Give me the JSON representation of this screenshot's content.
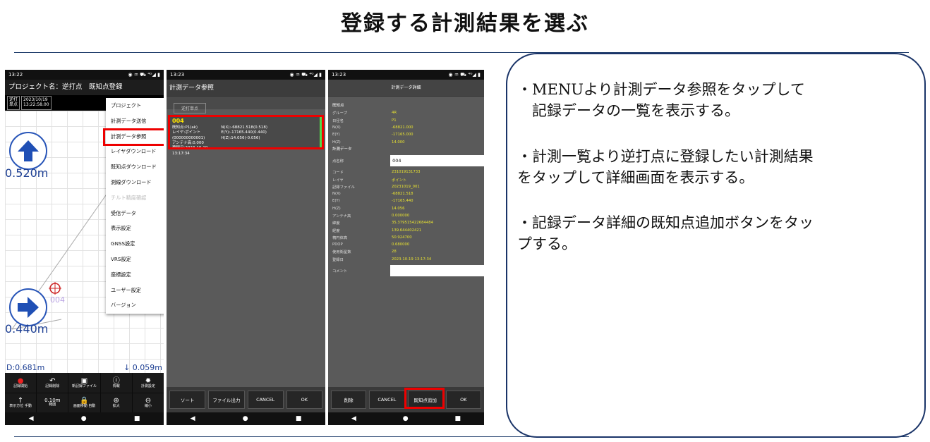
{
  "title": "登録する計測結果を選ぶ",
  "phone1": {
    "time": "13:22",
    "status_icons": "◉ ♒ ⛟ ⁴ᴳ◢ ▮",
    "header": "プロジェクト名：逆打点　既知点登録",
    "mode_a": "逆打",
    "mode_b": "単点",
    "date": "2023/10/19",
    "clock": "13:22:58.00",
    "dist_top": "0.520m",
    "dist_bottom": "0.440m",
    "d_label": "D:0.681m",
    "v_label": "↓ 0.059m",
    "point_label": "004",
    "menu": [
      "プロジェクト",
      "計測データ送信",
      "計測データ参照",
      "レイヤダウンロード",
      "既知点ダウンロード",
      "測線ダウンロード",
      "チルト精度確認",
      "受信データ",
      "表示設定",
      "GNSS設定",
      "VRS設定",
      "座標設定",
      "ユーザー設定",
      "バージョン"
    ],
    "toolbar": [
      {
        "icon": "●",
        "label": "記録開始"
      },
      {
        "icon": "↶",
        "label": "記録削除"
      },
      {
        "icon": "▣",
        "label": "新記録ファイル"
      },
      {
        "icon": "ⓘ",
        "label": "情報"
      },
      {
        "icon": "✹",
        "label": "計測設定"
      },
      {
        "icon": "↑",
        "label": "表示方位 手動"
      },
      {
        "icon": "0.10m",
        "label": "範囲"
      },
      {
        "icon": "🔒",
        "label": "画面移動 自動"
      },
      {
        "icon": "⊕",
        "label": "拡大"
      },
      {
        "icon": "⊖",
        "label": "縮小"
      }
    ]
  },
  "phone2": {
    "time": "13:23",
    "header": "計測データ参照",
    "tab": "逆打単点",
    "record_id": "004",
    "l1": "既知点:P1(ak)",
    "l2": "レイヤ:ポイント(000000000001)",
    "l3": "アンテナ高:0.000",
    "l4": "登録日:2023-10-19 13:17:34",
    "r1": "N(X):-68821.518(0.518)",
    "r2": "E(Y):-17165.440(0.440)",
    "r3": "H(Z):14.056(-0.056)",
    "buttons": [
      "ソート",
      "ファイル出力",
      "CANCEL",
      "OK"
    ]
  },
  "phone3": {
    "time": "13:23",
    "header": "計測データ詳細",
    "sec1": "既知点",
    "known": [
      {
        "k": "グループ",
        "v": "4R"
      },
      {
        "k": "日径名",
        "v": "P1"
      },
      {
        "k": "N(X)",
        "v": "-68821.000"
      },
      {
        "k": "E(Y)",
        "v": "-17165.000"
      },
      {
        "k": "H(Z)",
        "v": "14.000"
      }
    ],
    "sec2": "計測データ",
    "name_label": "点名称",
    "name_value": "004",
    "meas": [
      {
        "k": "コード",
        "v": "231019131733"
      },
      {
        "k": "レイヤ",
        "v": "ポイント"
      },
      {
        "k": "記録ファイル",
        "v": "20231019_001"
      },
      {
        "k": "N(X)",
        "v": "-68821.518"
      },
      {
        "k": "E(Y)",
        "v": "-17165.440"
      },
      {
        "k": "H(Z)",
        "v": "14.056"
      },
      {
        "k": "アンテナ高",
        "v": "0.000000"
      },
      {
        "k": "緯度",
        "v": "35.379515422684484"
      },
      {
        "k": "経度",
        "v": "139.644402421"
      },
      {
        "k": "楕円体高",
        "v": "50.924700"
      },
      {
        "k": "PDOP",
        "v": "0.680000"
      },
      {
        "k": "使用衛星数",
        "v": "28"
      },
      {
        "k": "登録日",
        "v": "2023-10-19 13:17:34"
      }
    ],
    "comment_label": "コメント",
    "buttons": [
      "削除",
      "CANCEL",
      "既知点追加",
      "OK"
    ]
  },
  "description": {
    "p1a": "・MENUより計測データ参照をタップして",
    "p1b": "　記録データの一覧を表示する。",
    "p2a": "・計測一覧より逆打点に登録したい計測結果",
    "p2b": "をタップして詳細画面を表示する。",
    "p3a": "・記録データ詳細の既知点追加ボタンをタッ",
    "p3b": "プする。"
  },
  "nav": {
    "back": "◀",
    "home": "●",
    "recent": "■"
  }
}
